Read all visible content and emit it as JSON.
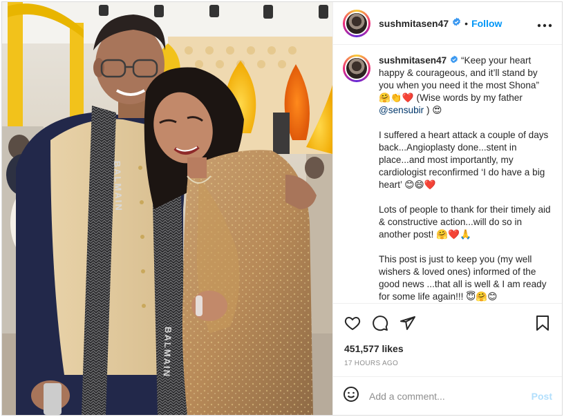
{
  "header": {
    "username": "sushmitasen47",
    "separator": "•",
    "follow_label": "Follow",
    "more_icon": "more-options-icon"
  },
  "caption": {
    "username": "sushmitasen47",
    "paragraphs": [
      "I suffered a heart attack a couple of days back...Angioplasty done...stent in place...and most importantly, my cardiologist reconfirmed ‘I do have a big heart’ 😊😄❤️",
      "Lots of people to thank for their timely aid & constructive action...will do so in another post! 🤗❤️🙏",
      "This post is just to keep you (my well wishers & loved ones) informed of the good news ...that all is well & I am ready for some life again!!! 😇🤗😊"
    ],
    "first_text": "“Keep your heart happy & courageous, and it’ll stand by you when you need it the most Shona” 🤗👏❤️ (Wise words by my father ",
    "mention": "@sensubir",
    "first_text_end": " ) 😍"
  },
  "actions": {
    "like_icon": "heart-icon",
    "comment_icon": "comment-icon",
    "share_icon": "share-icon",
    "save_icon": "bookmark-icon"
  },
  "likes": "451,577 likes",
  "time_ago": "17 HOURS AGO",
  "comment": {
    "placeholder": "Add a comment...",
    "post_label": "Post",
    "emoji_icon": "emoji-icon"
  },
  "photo": {
    "scarf_text": "BALMAIN"
  },
  "colors": {
    "accent": "#0095f6",
    "post_disabled": "#b2dffc",
    "verified": "#3897f0",
    "muted": "#8e8e8e"
  }
}
